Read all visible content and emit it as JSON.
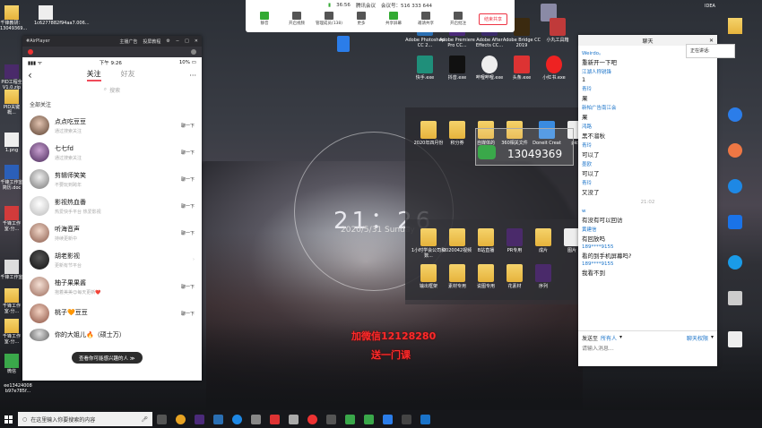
{
  "desktop": {
    "clock_time": "21：26",
    "clock_date": "2020/5/31 Sunday",
    "overlay_red_1": "加微信12128280",
    "overlay_red_2": "送一门课",
    "watermark_number": "13049369",
    "left_icons": [
      "千锋教研：13049369...",
      "1c6277882f94aa7.006...",
      "PID工程全V1.0.zip",
      "PID关键概...",
      "1.png",
      "千锋工作室简历.doc",
      "千锋工作室-分...",
      "千锋工作室",
      "千锋工作室-分...",
      "千锋工作室-分...",
      "微信",
      "ee13424008 b97e785f..."
    ],
    "right_icons": [
      "IDEA",
      "Adobe Photoshop CC 2...",
      "Adobe Premiere Pro CC...",
      "Adobe After Effects CC...",
      "Adobe Bridge CC 2019",
      "小丸工具箱",
      "快手.exe",
      "抖音.exe",
      "哔哩哔哩.exe",
      "头条.exe",
      "小红书.exe"
    ],
    "inner_folders": [
      "2020年四月份",
      "积分券",
      "自媒体的",
      "360相关文件",
      "Doneit Creat",
      "pict",
      "1小时学会公司和数...",
      "2020042视频",
      "B站直播",
      "PR专用",
      "成片",
      "图片",
      "输出框架",
      "素材专用",
      "说图专用",
      "花素材",
      "序列"
    ]
  },
  "player": {
    "title": "#AirPlayer",
    "bar_links": [
      "主播广告",
      "投屏教程"
    ],
    "status_time": "下午 9:26",
    "status_battery": "10%",
    "nav_back": "‹",
    "tab_following": "关注",
    "tab_friends": "好友",
    "nav_more": "···",
    "search_placeholder": "搜索",
    "section_title": "全部关注",
    "rows": [
      {
        "name": "点点吃豆豆",
        "sub": "通过搜索关注",
        "action": "聊一下"
      },
      {
        "name": "七七fd",
        "sub": "通过搜索关注",
        "action": "聊一下"
      },
      {
        "name": "剪辑师笑笑",
        "sub": "不要玩到跨年",
        "action": "聊一下"
      },
      {
        "name": "影视热血番",
        "sub": "热爱快手平台 热爱影视",
        "action": "聊一下"
      },
      {
        "name": "听海音声",
        "sub": "持续更新中",
        "action": "聊一下"
      },
      {
        "name": "胡老影视",
        "sub": "更新有节平台",
        "action": ""
      },
      {
        "name": "柚子果果酱",
        "sub": "抱着美美😊每天更新❤️",
        "action": "聊一下"
      },
      {
        "name": "桃子🧡豆豆",
        "sub": "",
        "action": "聊一下"
      },
      {
        "name": "你的大姐儿🔥（硕士万）",
        "sub": "",
        "action": ""
      }
    ],
    "toast": "查看你可能感兴趣的人 ≫"
  },
  "meeting": {
    "time": "36:56",
    "app": "腾讯会议",
    "meeting_id_label": "会议号：516 333 644",
    "buttons": [
      "静音",
      "开启视频",
      "管理成员(138)",
      "更多",
      "共享屏幕",
      "邀请共享",
      "开启批注"
    ],
    "end_button": "结束共享"
  },
  "chat": {
    "title": "聊天",
    "mini_label": "正在讲话:",
    "messages": [
      {
        "name": "Weirdo。",
        "text": "重新开一下吧"
      },
      {
        "name": "江湖人称锐锋",
        "text": "1"
      },
      {
        "name": "青玲",
        "text": "果"
      },
      {
        "name": "新帕广告南江会",
        "text": "果"
      },
      {
        "name": "鸿路",
        "text": "黑不溜秋"
      },
      {
        "name": "青玲",
        "text": "可以了"
      },
      {
        "name": "墨欧",
        "text": "可以了"
      },
      {
        "name": "青玲",
        "text": "又没了"
      }
    ],
    "timestamp": "21:02",
    "messages2": [
      {
        "name": "w",
        "text": "有没有可以回访"
      },
      {
        "name": "黄建信",
        "text": "有回放吗"
      },
      {
        "name": "189****9155",
        "text": "看的到手机屏幕吗?"
      },
      {
        "name": "189****9155",
        "text": "我看不到"
      }
    ],
    "send_to_label": "发送至",
    "send_to_value": "所有人",
    "permission_label": "聊天权限",
    "input_placeholder": "请输入消息..."
  },
  "taskbar": {
    "search_placeholder": "在这里输入你要搜索的内容"
  }
}
